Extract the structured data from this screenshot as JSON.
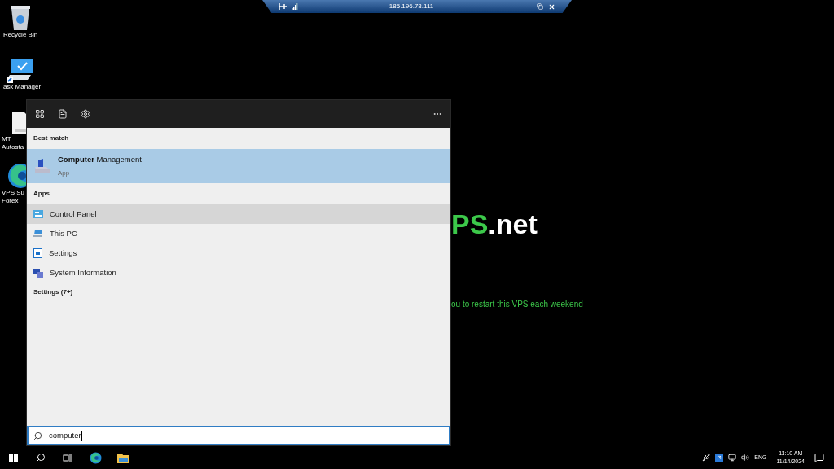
{
  "connection_bar": {
    "title": "185.196.73.111"
  },
  "desktop_icons": [
    {
      "label": "Recycle Bin",
      "kind": "bin"
    },
    {
      "label": "Task Manager",
      "kind": "monitor"
    },
    {
      "label": "MT\nAutosta",
      "kind": "doc"
    },
    {
      "label": "VPS Su\nForex",
      "kind": "edge"
    }
  ],
  "wallpaper": {
    "logo_accent": "PS",
    "logo_rest": ".net",
    "notice": "ou to restart this VPS each weekend"
  },
  "search_panel": {
    "best_match_header": "Best match",
    "best_match": {
      "title": "**Computer** Management",
      "subtitle": "App",
      "selected": true
    },
    "apps_header": "Apps",
    "apps": [
      {
        "label": "Control Panel",
        "kind": "control",
        "selected": true
      },
      {
        "label": "This PC",
        "kind": "pc",
        "selected": false
      },
      {
        "label": "Settings",
        "kind": "settings",
        "selected": false
      },
      {
        "label": "System Information",
        "kind": "info",
        "selected": false
      }
    ],
    "settings_header": "Settings (7+)",
    "query": "computer"
  },
  "taskbar": {
    "language": "ENG",
    "time": "11:10 AM",
    "date": "11/14/2024"
  }
}
